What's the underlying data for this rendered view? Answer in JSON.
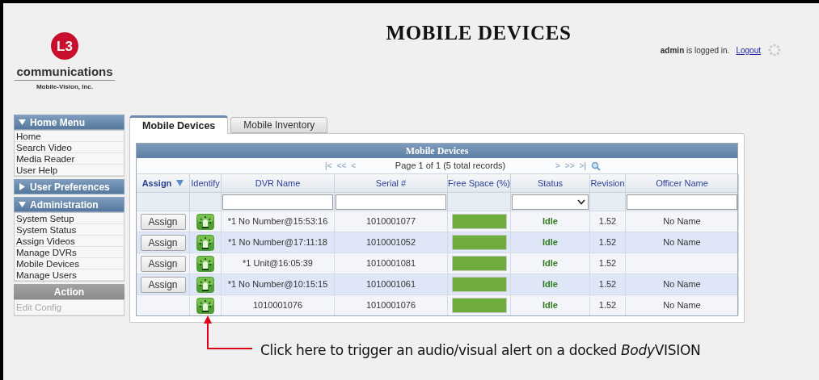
{
  "header": {
    "title": "MOBILE DEVICES",
    "logo": {
      "mark": "L3",
      "name": "communications",
      "subtitle": "Mobile-Vision, Inc."
    },
    "user": "admin",
    "login_text": "is logged in.",
    "logout": "Logout"
  },
  "sidebar": [
    {
      "kind": "menu",
      "title": "Home Menu",
      "expanded": true,
      "items": [
        {
          "label": "Home",
          "disabled": false
        },
        {
          "label": "Search Video",
          "disabled": false
        },
        {
          "label": "Media Reader",
          "disabled": false
        },
        {
          "label": "User Help",
          "disabled": false
        }
      ]
    },
    {
      "kind": "menu",
      "title": "User Preferences",
      "expanded": false
    },
    {
      "kind": "menu",
      "title": "Administration",
      "expanded": true,
      "items": [
        {
          "label": "System Setup",
          "disabled": false
        },
        {
          "label": "System Status",
          "disabled": false
        },
        {
          "label": "Assign Videos",
          "disabled": false
        },
        {
          "label": "Manage DVRs",
          "disabled": false
        },
        {
          "label": "Mobile Devices",
          "disabled": false
        },
        {
          "label": "Manage Users",
          "disabled": false
        }
      ]
    },
    {
      "kind": "action",
      "title": "Action",
      "items": [
        {
          "label": "Edit Config",
          "disabled": true
        }
      ]
    }
  ],
  "tabs": [
    {
      "label": "Mobile Devices",
      "selected": true
    },
    {
      "label": "Mobile Inventory",
      "selected": false
    }
  ],
  "table": {
    "title": "Mobile Devices",
    "pager": {
      "back": [
        "|<",
        "<<",
        "<"
      ],
      "info": "Page 1 of 1 (5 total records)",
      "forward": [
        ">",
        ">>",
        ">|"
      ]
    },
    "columns": [
      "Assign",
      "Identify",
      "DVR Name",
      "Serial #",
      "Free Space (%)",
      "Status",
      "Revision",
      "Officer Name"
    ],
    "rows": [
      {
        "assign": "Assign",
        "dvr_name": "*1 No Number@15:53:16",
        "serial": "1010001077",
        "free_space": {
          "level": 1
        },
        "status": "Idle",
        "revision": "1.52",
        "officer": "No Name"
      },
      {
        "assign": "Assign",
        "dvr_name": "*1 No Number@17:11:18",
        "serial": "1010001052",
        "free_space": {
          "level": 1
        },
        "status": "Idle",
        "revision": "1.52",
        "officer": "No Name"
      },
      {
        "assign": "Assign",
        "dvr_name": "*1 Unit@16:05:39",
        "serial": "1010001081",
        "free_space": {
          "level": 1
        },
        "status": "Idle",
        "revision": "1.52"
      },
      {
        "assign": "Assign",
        "dvr_name": "*1 No Number@10:15:15",
        "serial": "1010001061",
        "free_space": {
          "level": 1
        },
        "status": "Idle",
        "revision": "1.52",
        "officer": "No Name"
      },
      {
        "dvr_name": "1010001076",
        "serial": "1010001076",
        "free_space": {
          "level": 1
        },
        "status": "Idle",
        "revision": "1.52",
        "officer": "No Name"
      }
    ]
  },
  "callout": {
    "text": "Click here to trigger an audio/visual alert on a docked ",
    "italic": "Body",
    "rest": "VISION"
  }
}
